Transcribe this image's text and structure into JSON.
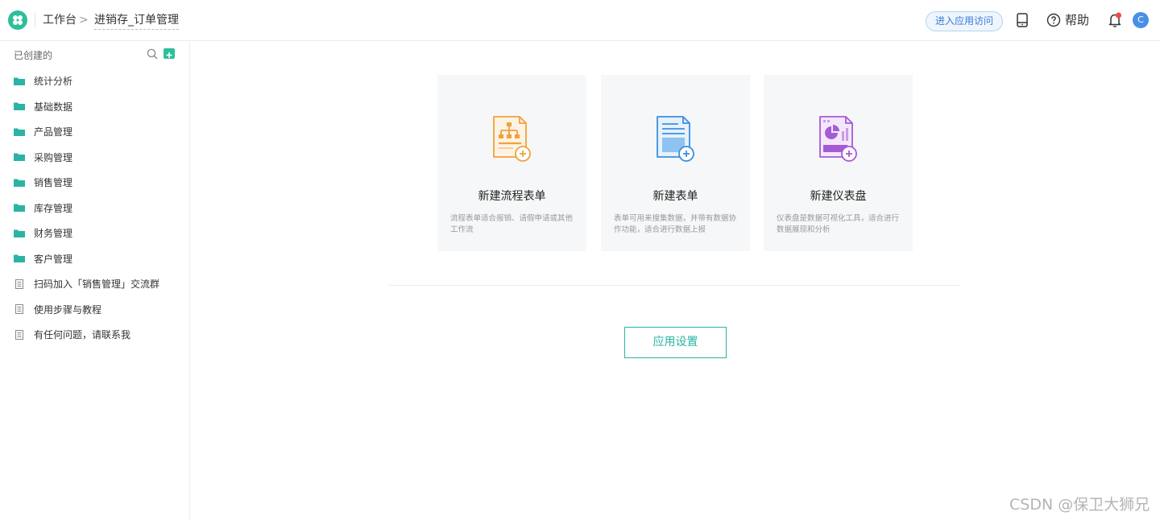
{
  "header": {
    "breadcrumb_root": "工作台",
    "breadcrumb_separator": ">",
    "breadcrumb_current": "进销存_订单管理",
    "visit_button": "进入应用访问",
    "help_label": "帮助",
    "avatar_letter": "C"
  },
  "sidebar": {
    "heading": "已创建的",
    "items": [
      {
        "label": "统计分析",
        "icon": "folder-icon"
      },
      {
        "label": "基础数据",
        "icon": "folder-icon"
      },
      {
        "label": "产品管理",
        "icon": "folder-icon"
      },
      {
        "label": "采购管理",
        "icon": "folder-icon"
      },
      {
        "label": "销售管理",
        "icon": "folder-icon"
      },
      {
        "label": "库存管理",
        "icon": "folder-icon"
      },
      {
        "label": "财务管理",
        "icon": "folder-icon"
      },
      {
        "label": "客户管理",
        "icon": "folder-icon"
      },
      {
        "label": "扫码加入「销售管理」交流群",
        "icon": "document-icon"
      },
      {
        "label": "使用步骤与教程",
        "icon": "document-icon"
      },
      {
        "label": "有任何问题，请联系我",
        "icon": "document-icon"
      }
    ]
  },
  "cards": [
    {
      "title": "新建流程表单",
      "desc": "流程表单适合报销、请假申请或其他工作流",
      "icon": "flow-form-icon",
      "color": "#f0a13a"
    },
    {
      "title": "新建表单",
      "desc": "表单可用来搜集数据，并带有数据协作功能，适合进行数据上报",
      "icon": "form-icon",
      "color": "#3a8fe0"
    },
    {
      "title": "新建仪表盘",
      "desc": "仪表盘是数据可视化工具，适合进行数据展现和分析",
      "icon": "dashboard-icon",
      "color": "#a65bd6"
    }
  ],
  "settings_button": "应用设置",
  "watermark": "CSDN @保卫大狮兄",
  "colors": {
    "accent": "#2bbf9a",
    "border_accent": "#2bb3a4",
    "link_blue": "#3b7bd4"
  }
}
